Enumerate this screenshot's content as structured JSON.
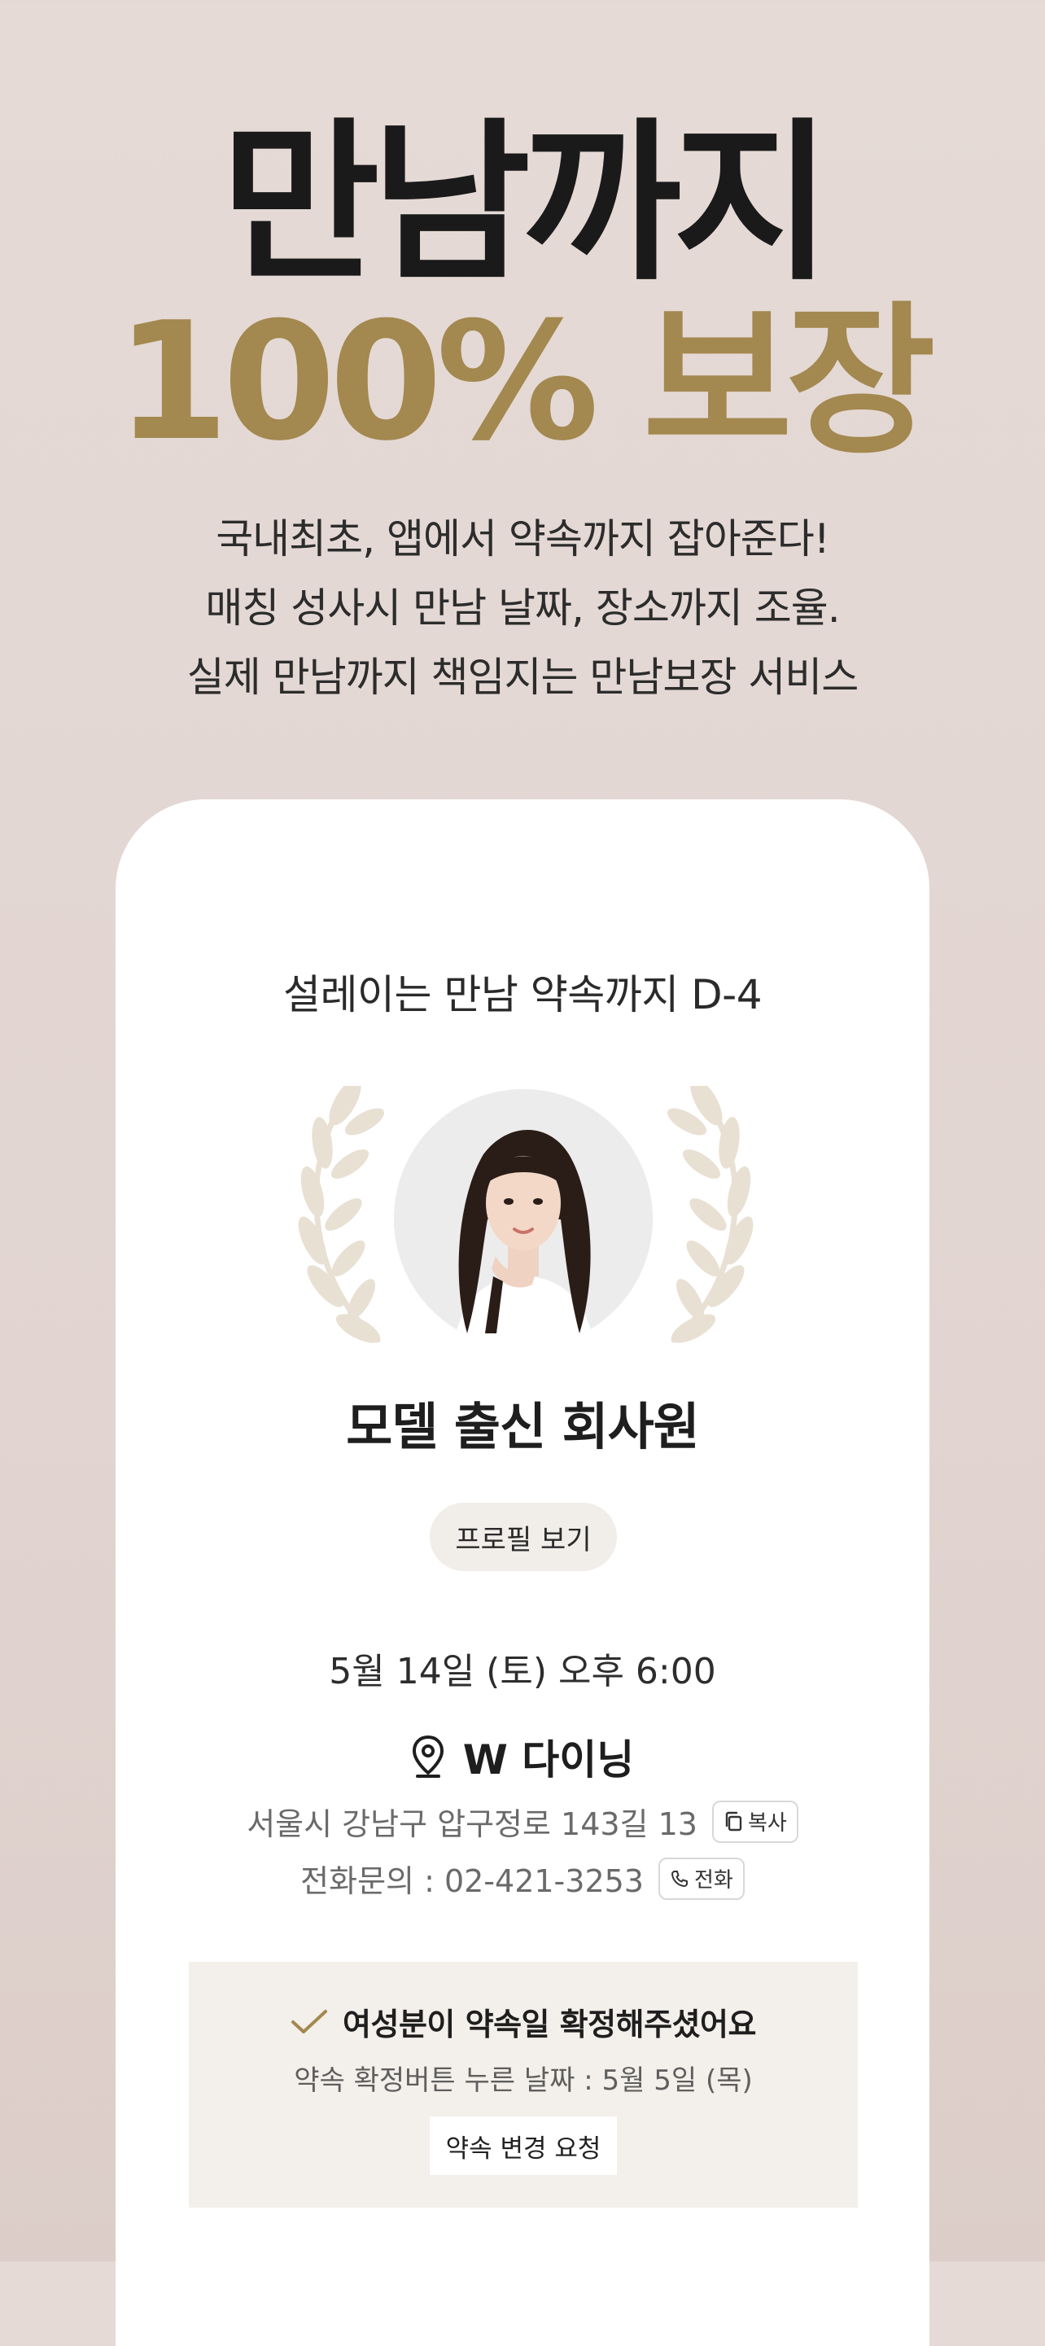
{
  "hero": {
    "headline_line1": "만남까지",
    "headline_line2": "100% 보장",
    "subcopy_line1": "국내최초, 앱에서 약속까지 잡아준다!",
    "subcopy_line2": "매칭 성사시 만남 날짜, 장소까지 조율.",
    "subcopy_line3": "실제 만남까지 책임지는 만남보장 서비스"
  },
  "card": {
    "countdown": "설레이는 만남 약속까지 D-4",
    "profile_name": "모델 출신 회사원",
    "profile_button": "프로필 보기",
    "datetime": "5월 14일 (토) 오후 6:00",
    "place_name": "W 다이닝",
    "address": "서울시 강남구 압구정로 143길 13",
    "copy_button": "복사",
    "phone_text": "전화문의 : 02-421-3253",
    "call_button": "전화"
  },
  "confirm": {
    "title": "여성분이 약속일 확정해주셨어요",
    "subtitle": "약속 확정버튼 누른  날짜 : 5월 5일 (목)",
    "change_button": "약속 변경 요청"
  },
  "colors": {
    "accent_gold": "#a3884f",
    "background": "#e4d8d4",
    "laurel": "#e8e0d2",
    "confirm_bg": "#f3efea"
  },
  "icons": [
    "laurel-left-icon",
    "laurel-right-icon",
    "location-pin-icon",
    "copy-icon",
    "phone-icon",
    "check-icon"
  ]
}
